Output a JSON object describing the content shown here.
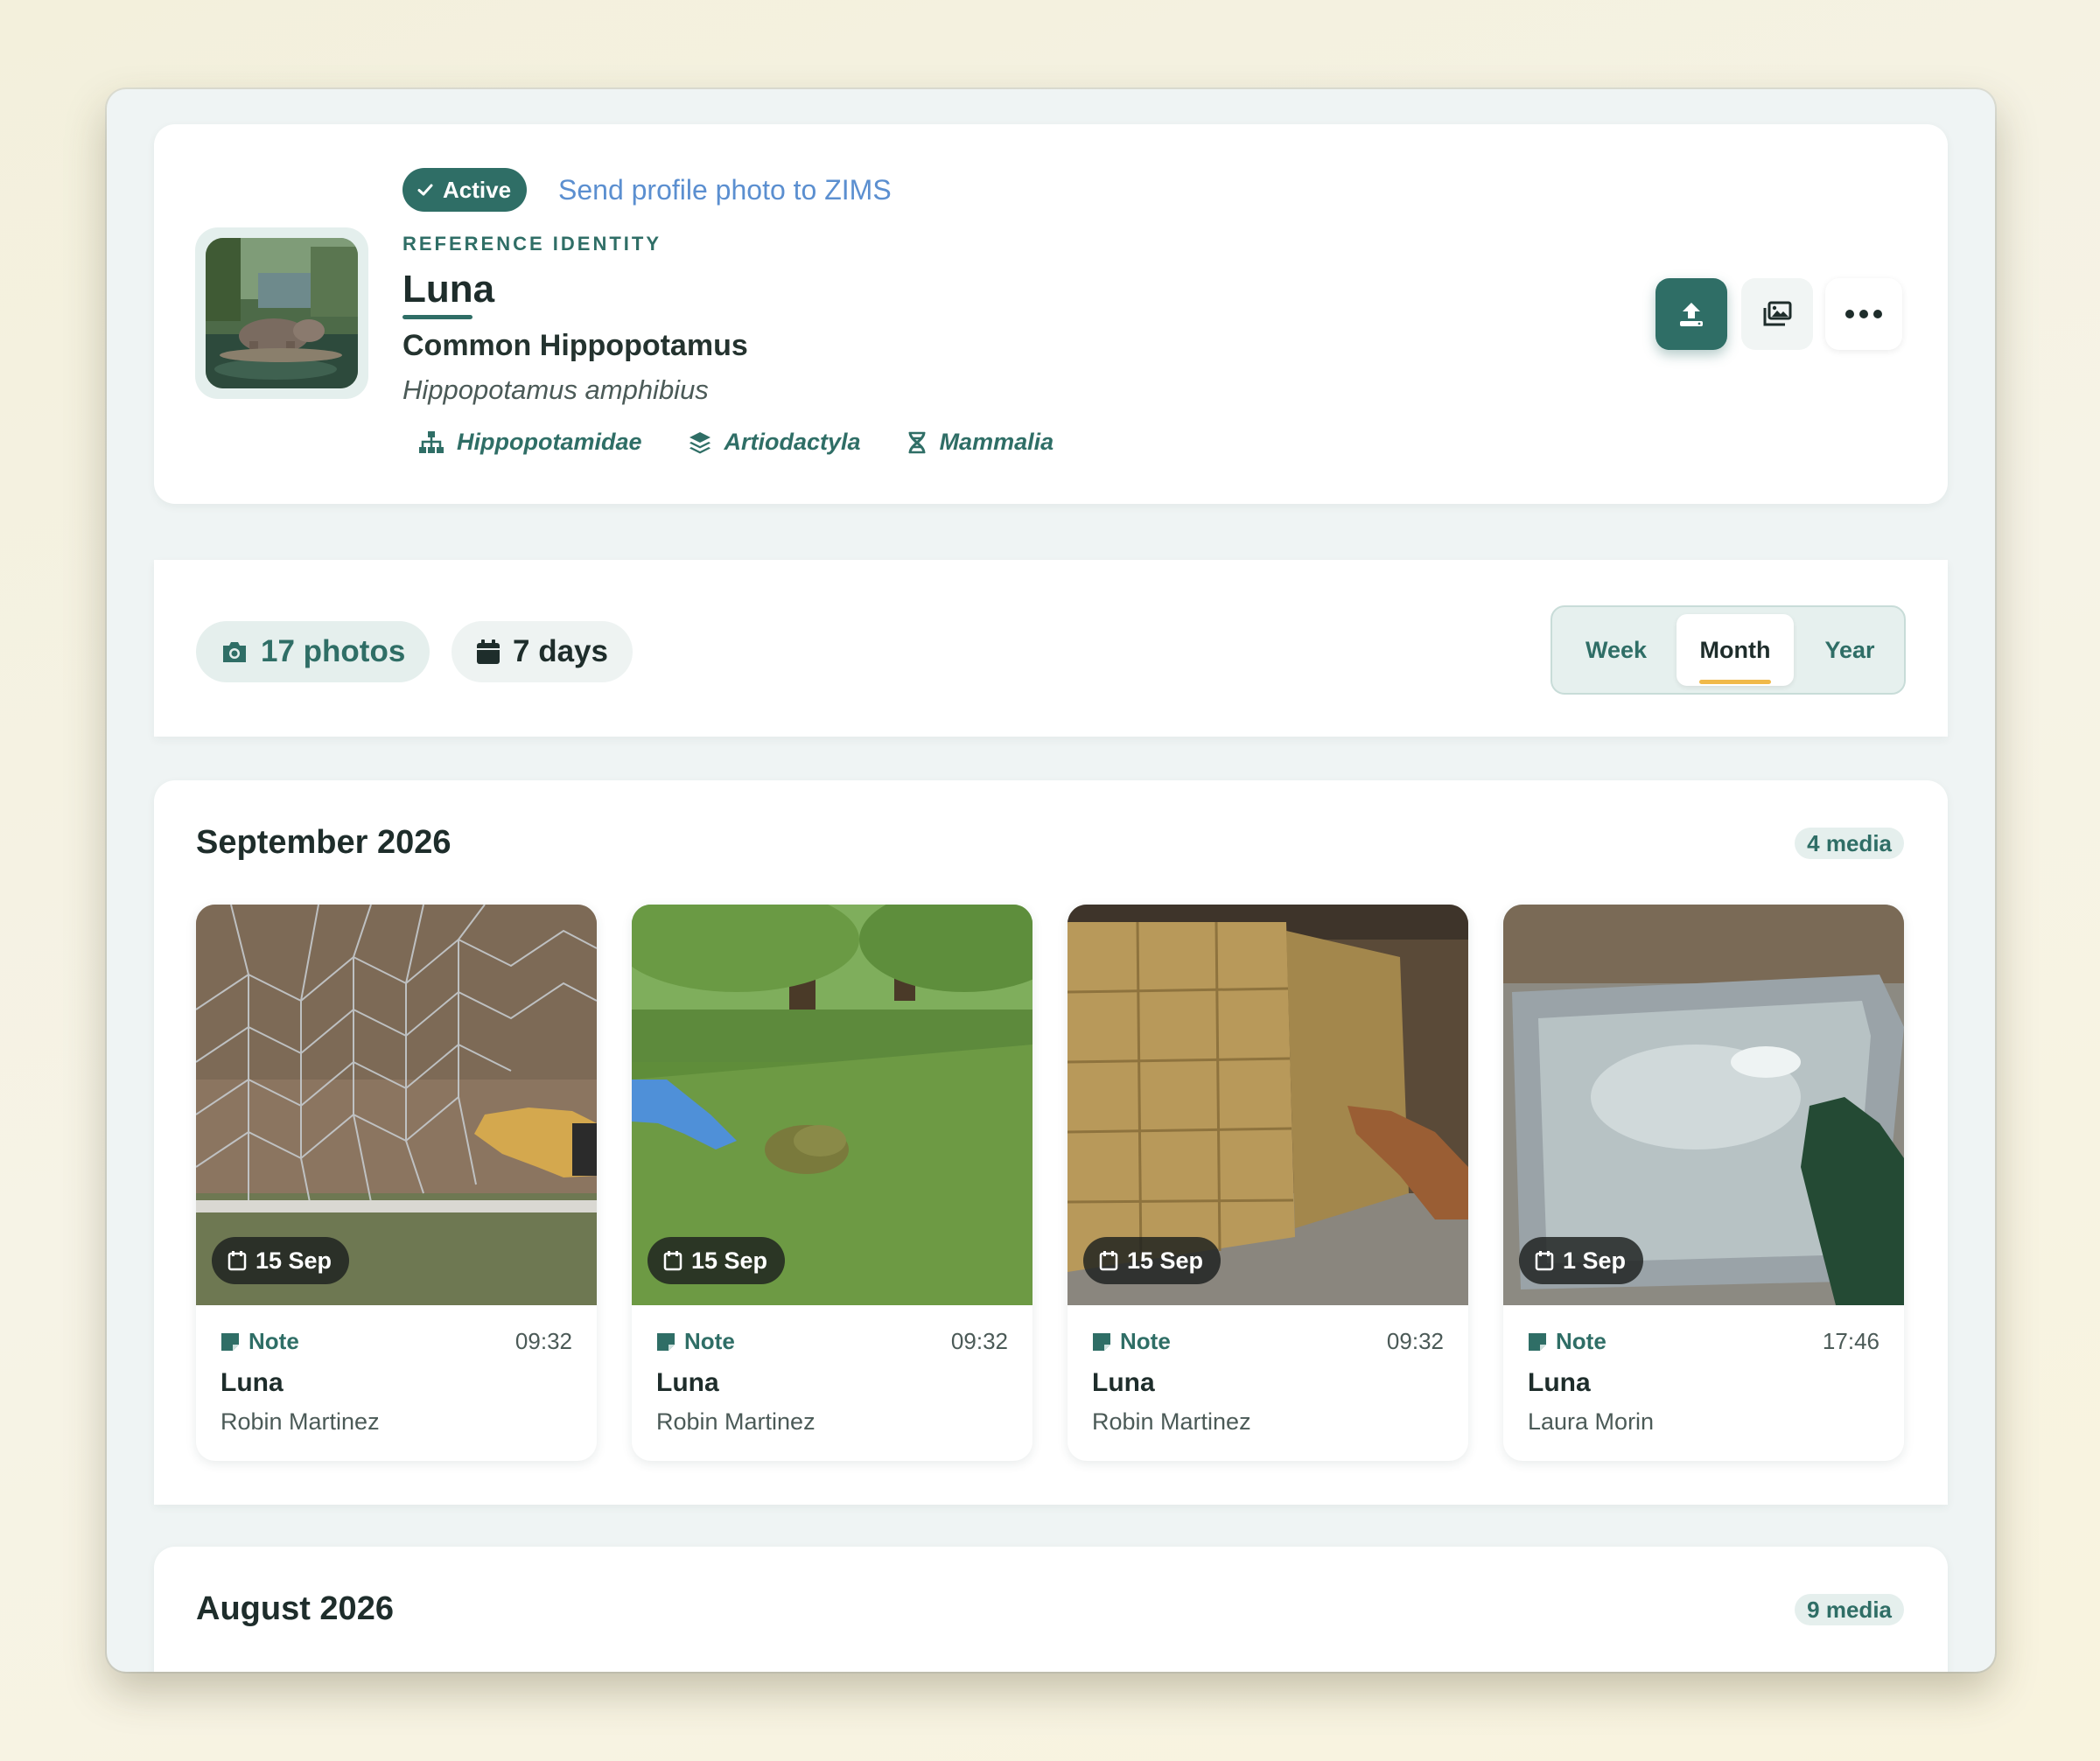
{
  "profile": {
    "status": "Active",
    "send_link": "Send profile photo to ZIMS",
    "ref_label": "REFERENCE IDENTITY",
    "name": "Luna",
    "common_name": "Common Hippopotamus",
    "scientific_name": "Hippopotamus amphibius",
    "taxonomy": [
      {
        "label": "Hippopotamidae",
        "icon": "hierarchy-icon"
      },
      {
        "label": "Artiodactyla",
        "icon": "layers-icon"
      },
      {
        "label": "Mammalia",
        "icon": "dna-icon"
      }
    ],
    "actions": [
      {
        "icon": "upload-icon"
      },
      {
        "icon": "gallery-icon"
      },
      {
        "icon": "more-icon"
      }
    ]
  },
  "filters": {
    "photos": "17 photos",
    "days": "7 days",
    "periods": [
      "Week",
      "Month",
      "Year"
    ],
    "selected_period": "Month"
  },
  "months": [
    {
      "title": "September 2026",
      "count": "4 media",
      "items": [
        {
          "date": "15 Sep",
          "type": "Note",
          "time": "09:32",
          "name": "Luna",
          "author": "Robin Martinez"
        },
        {
          "date": "15 Sep",
          "type": "Note",
          "time": "09:32",
          "name": "Luna",
          "author": "Robin Martinez"
        },
        {
          "date": "15 Sep",
          "type": "Note",
          "time": "09:32",
          "name": "Luna",
          "author": "Robin Martinez"
        },
        {
          "date": "1 Sep",
          "type": "Note",
          "time": "17:46",
          "name": "Luna",
          "author": "Laura Morin"
        }
      ]
    },
    {
      "title": "August 2026",
      "count": "9 media",
      "items": []
    }
  ],
  "colors": {
    "accent": "#2f6e66",
    "link": "#5b8fd0",
    "highlight": "#f0b94a"
  }
}
